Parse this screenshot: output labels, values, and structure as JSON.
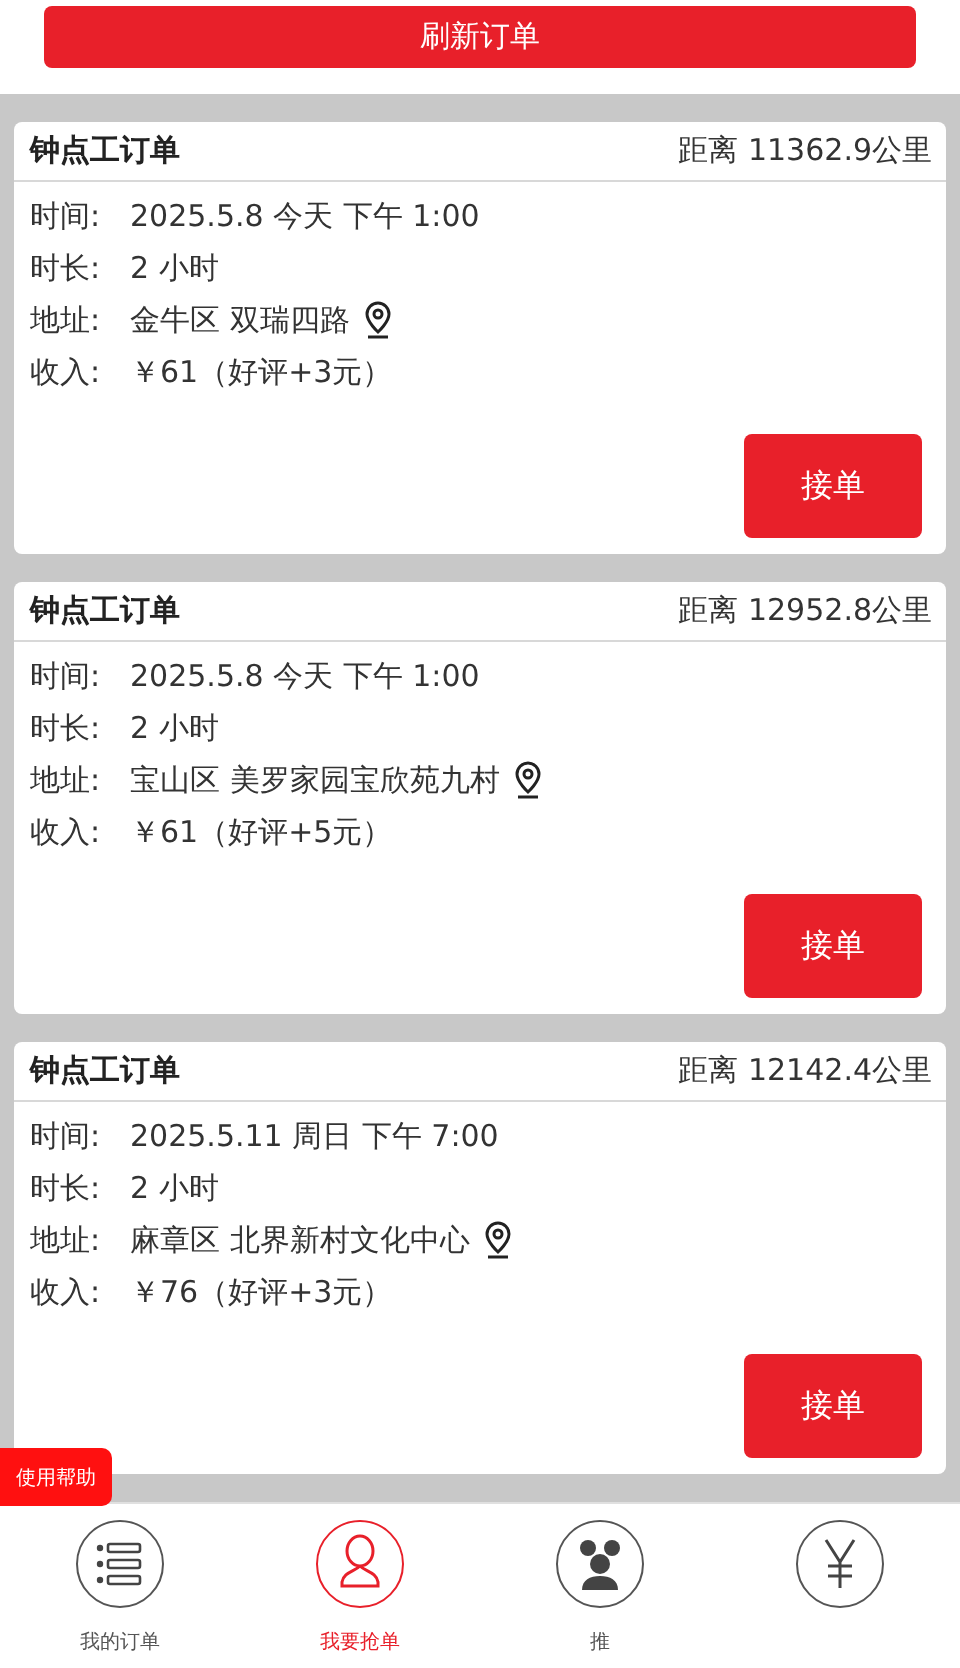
{
  "refresh_button": "刷新订单",
  "orders": [
    {
      "title": "钟点工订单",
      "distance": "距离 11362.9公里",
      "rows": [
        {
          "label": "时间:",
          "value": "2025.5.8 今天 下午 1:00"
        },
        {
          "label": "时长:",
          "value": "2 小时"
        },
        {
          "label": "地址:",
          "value": "金牛区 双瑞四路",
          "kind": "address"
        },
        {
          "label": "收入:",
          "value": "￥61（好评+3元）"
        }
      ],
      "action": "接单"
    },
    {
      "title": "钟点工订单",
      "distance": "距离 12952.8公里",
      "rows": [
        {
          "label": "时间:",
          "value": "2025.5.8 今天 下午 1:00"
        },
        {
          "label": "时长:",
          "value": "2 小时"
        },
        {
          "label": "地址:",
          "value": "宝山区 美罗家园宝欣苑九村",
          "kind": "address"
        },
        {
          "label": "收入:",
          "value": "￥61（好评+5元）"
        }
      ],
      "action": "接单"
    },
    {
      "title": "钟点工订单",
      "distance": "距离 12142.4公里",
      "rows": [
        {
          "label": "时间:",
          "value": "2025.5.11 周日 下午 7:00"
        },
        {
          "label": "时长:",
          "value": "2 小时"
        },
        {
          "label": "地址:",
          "value": "麻章区 北界新村文化中心",
          "kind": "address"
        },
        {
          "label": "收入:",
          "value": "￥76（好评+3元）"
        }
      ],
      "action": "接单"
    }
  ],
  "help_badge": "使用帮助",
  "bottom_nav": [
    {
      "kind": "list",
      "label": "我的订单",
      "selected": false
    },
    {
      "kind": "person",
      "label": "我要抢单",
      "selected": true
    },
    {
      "kind": "group",
      "label": "推",
      "selected": false
    },
    {
      "kind": "yen",
      "selected": false
    }
  ]
}
